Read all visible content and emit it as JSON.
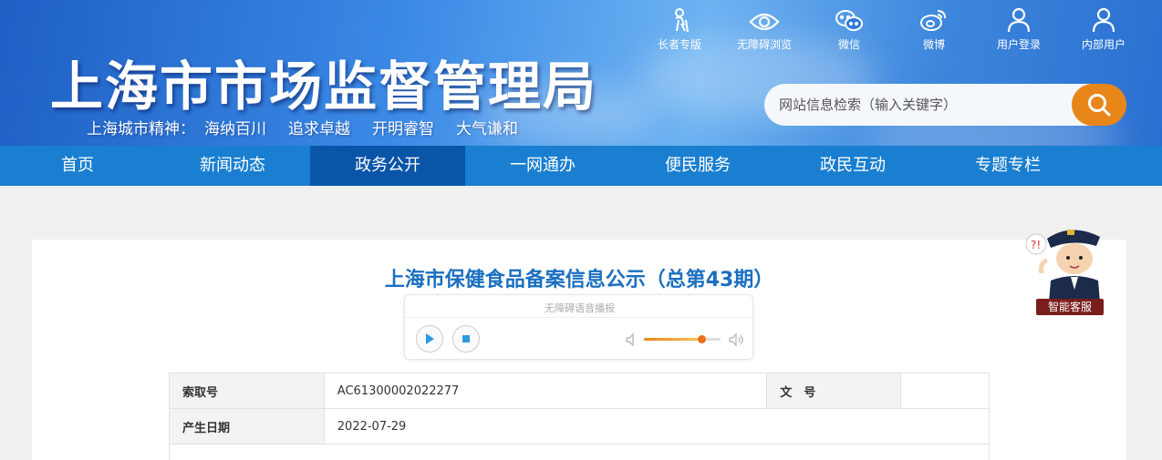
{
  "header": {
    "title": "上海市市场监督管理局",
    "spirit_label": "上海城市精神：",
    "spirit": [
      "海纳百川",
      "追求卓越",
      "开明睿智",
      "大气谦和"
    ],
    "toplinks": [
      {
        "label": "长者专版",
        "icon": "elder-icon"
      },
      {
        "label": "无障碍浏览",
        "icon": "eye-icon"
      },
      {
        "label": "微信",
        "icon": "wechat-icon"
      },
      {
        "label": "微博",
        "icon": "weibo-icon"
      },
      {
        "label": "用户登录",
        "icon": "user-icon"
      },
      {
        "label": "内部用户",
        "icon": "user-icon"
      }
    ],
    "search_placeholder": "网站信息检索（输入关键字）"
  },
  "nav": {
    "items": [
      "首页",
      "新闻动态",
      "政务公开",
      "一网通办",
      "便民服务",
      "政民互动",
      "专题专栏"
    ],
    "active": "政务公开"
  },
  "article": {
    "title": "上海市保健食品备案信息公示（总第43期）",
    "player_label": "无障碍语音播报",
    "volume": 0.76,
    "meta": {
      "index_label": "索取号",
      "index_value": "AC61300002022277",
      "doc_no_label": "文　号",
      "doc_no_value": "",
      "date_label": "产生日期",
      "date_value": "2022-07-29"
    }
  },
  "assistant": {
    "label": "智能客服"
  },
  "colors": {
    "accent": "#e8861a",
    "nav": "#1a7fd0",
    "nav_active": "#0a55a8",
    "title": "#1a6fc0"
  }
}
